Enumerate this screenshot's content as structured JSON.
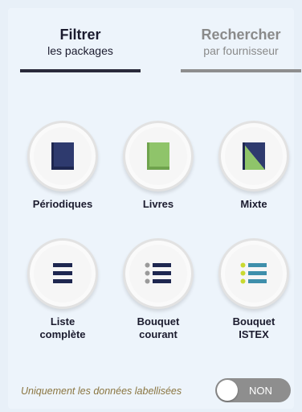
{
  "tabs": [
    {
      "line1": "Filtrer",
      "line2": "les packages",
      "active": true
    },
    {
      "line1": "Rechercher",
      "line2": "par fournisseur",
      "active": false
    }
  ],
  "tiles": [
    {
      "label": "Périodiques",
      "icon": "periodicals-book-icon"
    },
    {
      "label": "Livres",
      "icon": "books-icon"
    },
    {
      "label": "Mixte",
      "icon": "mixed-book-icon"
    },
    {
      "label1": "Liste",
      "label2": "complète",
      "icon": "list-icon"
    },
    {
      "label1": "Bouquet",
      "label2": "courant",
      "icon": "current-bouquet-list-icon"
    },
    {
      "label1": "Bouquet",
      "label2": "ISTEX",
      "icon": "istex-bouquet-list-icon"
    }
  ],
  "footer": {
    "label": "Uniquement les données labellisées",
    "toggle_text": "NON",
    "toggle_on": false
  },
  "colors": {
    "navy": "#2e3a6e",
    "green": "#8fc46a",
    "istex_teal": "#3e8fab",
    "istex_yellow": "#c9d930",
    "gray_bullet": "#9a9a9a",
    "dark": "#1b1b2e"
  }
}
